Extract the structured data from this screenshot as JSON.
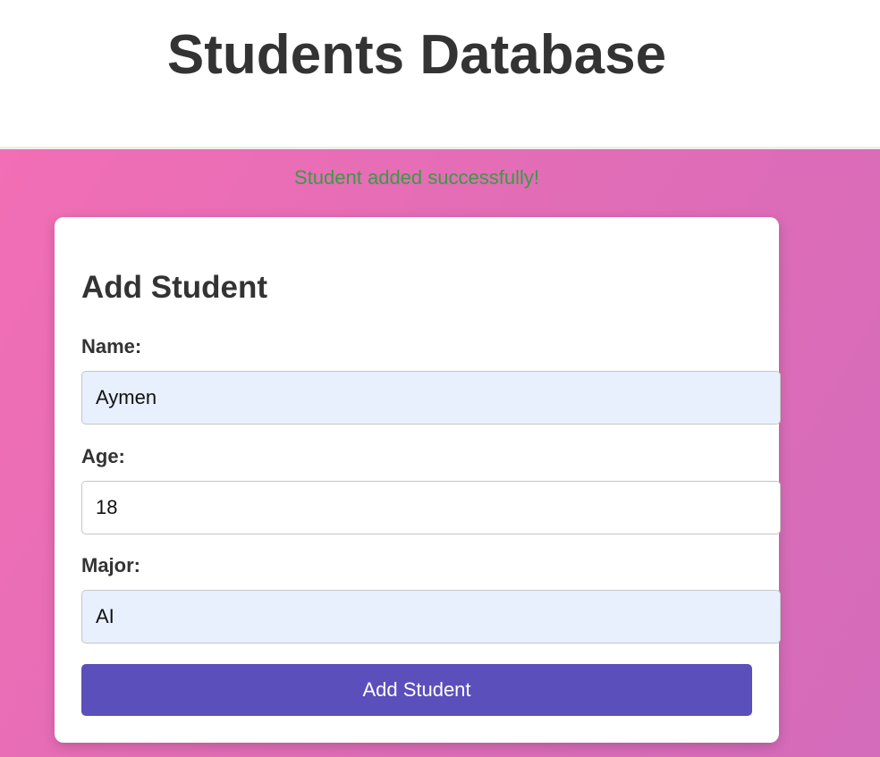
{
  "header": {
    "title": "Students Database"
  },
  "status": {
    "message": "Student added successfully!",
    "color": "#3a9a44"
  },
  "form": {
    "title": "Add Student",
    "fields": [
      {
        "label": "Name:",
        "value": "Aymen"
      },
      {
        "label": "Age:",
        "value": "18"
      },
      {
        "label": "Major:",
        "value": "AI"
      }
    ],
    "submit_label": "Add Student"
  },
  "colors": {
    "background_gradient": [
      "#f26eb5",
      "#d46bbb"
    ],
    "button": "#5b4fbb",
    "autofill_input": "#e8f0fe",
    "text": "#333333"
  }
}
